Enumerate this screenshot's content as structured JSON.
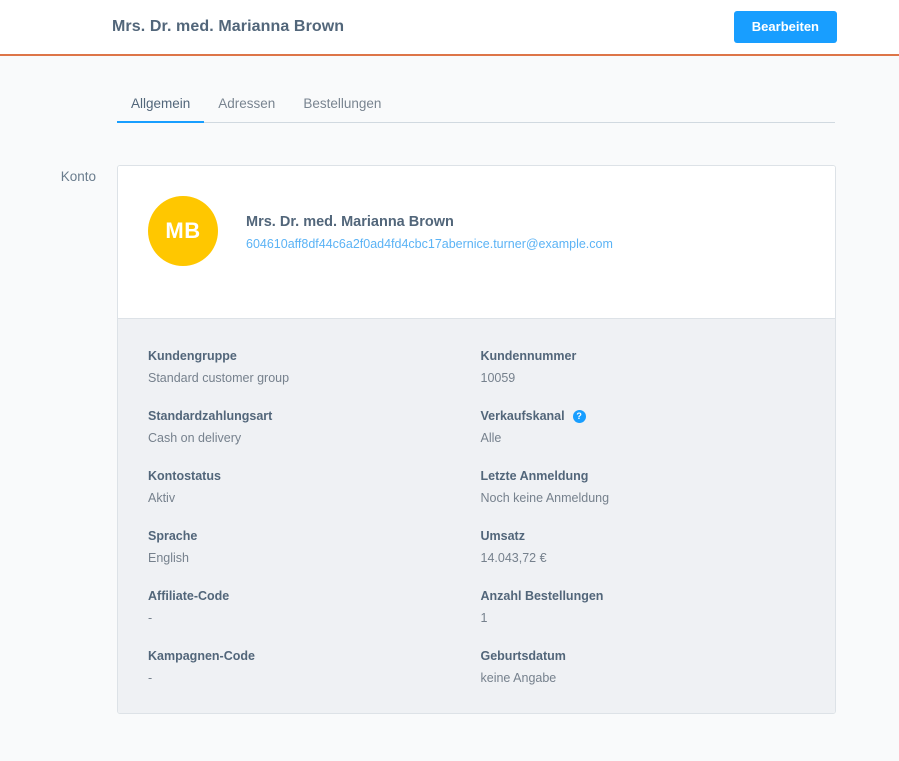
{
  "header": {
    "title": "Mrs. Dr. med. Marianna Brown",
    "edit_button": "Bearbeiten",
    "accent_color": "#189eff",
    "divider_color": "#dd7548"
  },
  "tabs": [
    {
      "label": "Allgemein",
      "active": true
    },
    {
      "label": "Adressen",
      "active": false
    },
    {
      "label": "Bestellungen",
      "active": false
    }
  ],
  "section": {
    "label": "Konto"
  },
  "account_card": {
    "avatar_initials": "MB",
    "avatar_color": "#ffc700",
    "name": "Mrs. Dr. med. Marianna Brown",
    "email": "604610aff8df44c6a2f0ad4fd4cbc17abernice.turner@example.com"
  },
  "fields": [
    {
      "label": "Kundengruppe",
      "value": "Standard customer group",
      "help": false
    },
    {
      "label": "Kundennummer",
      "value": "10059",
      "help": false
    },
    {
      "label": "Standardzahlungsart",
      "value": "Cash on delivery",
      "help": false
    },
    {
      "label": "Verkaufskanal",
      "value": "Alle",
      "help": true,
      "help_glyph": "?"
    },
    {
      "label": "Kontostatus",
      "value": "Aktiv",
      "help": false
    },
    {
      "label": "Letzte Anmeldung",
      "value": "Noch keine Anmeldung",
      "help": false
    },
    {
      "label": "Sprache",
      "value": "English",
      "help": false
    },
    {
      "label": "Umsatz",
      "value": "14.043,72 €",
      "help": false
    },
    {
      "label": "Affiliate-Code",
      "value": "-",
      "help": false
    },
    {
      "label": "Anzahl Bestellungen",
      "value": "1",
      "help": false
    },
    {
      "label": "Kampagnen-Code",
      "value": "-",
      "help": false
    },
    {
      "label": "Geburtsdatum",
      "value": "keine Angabe",
      "help": false
    }
  ]
}
